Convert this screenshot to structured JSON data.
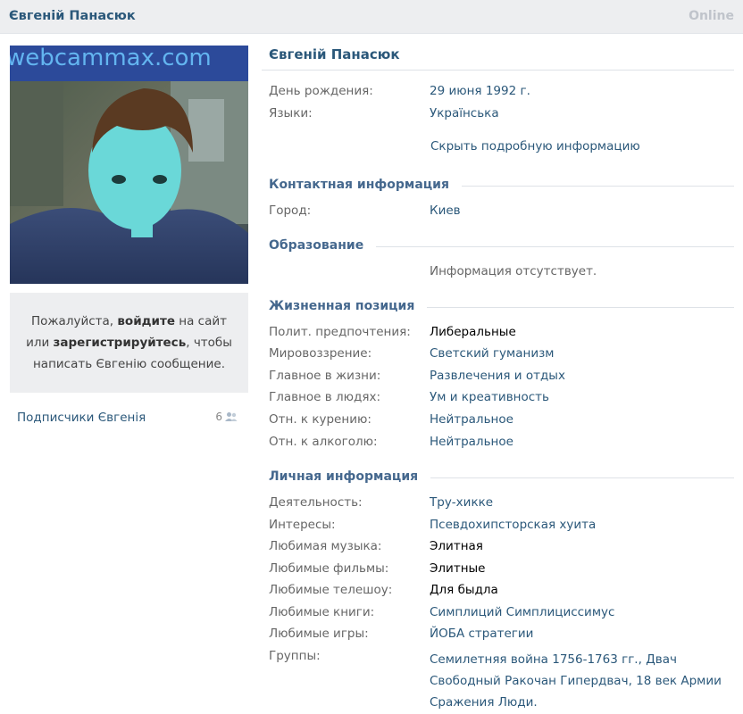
{
  "header": {
    "name": "Євгеній Панасюк",
    "status": "Online"
  },
  "sidebar": {
    "photo_watermark": "webcammax.com",
    "notice": {
      "part1": "Пожалуйста, ",
      "login": "войдите",
      "part2": " на сайт",
      "part3": "или ",
      "register": "зарегистрируйтесь",
      "part4": ", чтобы",
      "part5": "написать Євгенію сообщение."
    },
    "subscribers": {
      "label": "Подписчики Євгенія",
      "count": "6"
    }
  },
  "profile": {
    "name": "Євгеній Панасюк",
    "basic": [
      {
        "key": "День рождения:",
        "value": "29 июня 1992 г."
      },
      {
        "key": "Языки:",
        "value": "Українська"
      }
    ],
    "hide_details": "Скрыть подробную информацию",
    "contact": {
      "title": "Контактная информация",
      "rows": [
        {
          "key": "Город:",
          "value": "Киев"
        }
      ]
    },
    "education": {
      "title": "Образование",
      "empty": "Информация отсутствует."
    },
    "life_position": {
      "title": "Жизненная позиция",
      "rows": [
        {
          "key": "Полит. предпочтения:",
          "value": "Либеральные"
        },
        {
          "key": "Мировоззрение:",
          "value": "Светский гуманизм"
        },
        {
          "key": "Главное в жизни:",
          "value": "Развлечения и отдых"
        },
        {
          "key": "Главное в людях:",
          "value": "Ум и креативность"
        },
        {
          "key": "Отн. к курению:",
          "value": "Нейтральное"
        },
        {
          "key": "Отн. к алкоголю:",
          "value": "Нейтральное"
        }
      ]
    },
    "personal": {
      "title": "Личная информация",
      "rows": [
        {
          "key": "Деятельность:",
          "value": "Тру-хикке"
        },
        {
          "key": "Интересы:",
          "value": "Псевдохипсторская хуита"
        },
        {
          "key": "Любимая музыка:",
          "value": "Элитная"
        },
        {
          "key": "Любимые фильмы:",
          "value": "Элитные"
        },
        {
          "key": "Любимые телешоу:",
          "value": "Для быдла"
        },
        {
          "key": "Любимые книги:",
          "value": "Симплиций Симплициссимус"
        },
        {
          "key": "Любимые игры:",
          "value": "ЙОБА стратегии"
        }
      ],
      "groups_key": "Группы:",
      "groups": [
        {
          "name": "Семилетняя война 1756-1763 гг.",
          "sep": ", "
        },
        {
          "name": "Двач Свободный Ракочан Гипердвач",
          "sep": ", "
        },
        {
          "name": "18 век Армии Сражения Люди.",
          "sep": ""
        }
      ]
    }
  }
}
